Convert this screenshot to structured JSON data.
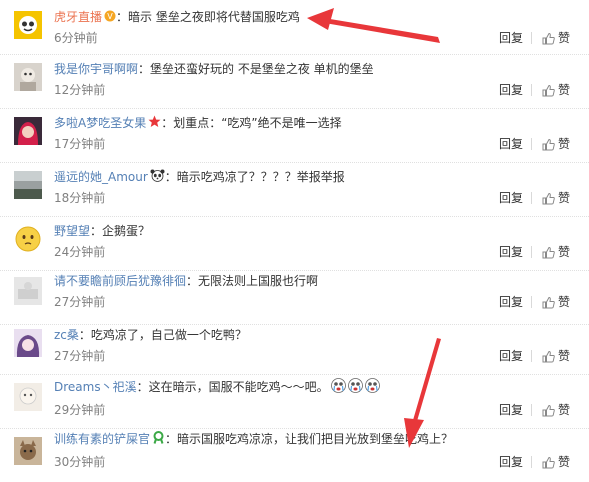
{
  "comments": [
    {
      "user": "虎牙直播",
      "text": "：暗示 堡垒之夜即将代替国服吃鸡",
      "time": "6分钟前"
    },
    {
      "user": "我是你宇哥啊啊",
      "text": "：堡垒还蛮好玩的 不是堡垒之夜 单机的堡垒",
      "time": "12分钟前"
    },
    {
      "user": "多啦A梦吃圣女果",
      "text": "：划重点：“吃鸡”绝不是唯一选择",
      "time": "17分钟前"
    },
    {
      "user": "遥远的她_Amour",
      "text": "：暗示吃鸡凉了？？？？举报举报",
      "time": "18分钟前"
    },
    {
      "user": "野望望",
      "text": "：企鹅蛋？",
      "time": "24分钟前"
    },
    {
      "user": "请不要瞻前顾后犹豫徘徊",
      "text": "：无限法则上国服也行啊",
      "time": "27分钟前"
    },
    {
      "user": "zc桑",
      "text": "：吃鸡凉了，自己做一个吃鸭？",
      "time": "27分钟前"
    },
    {
      "user": "Dreams丶祀溪",
      "text": "：这在暗示，国服不能吃鸡～～吧。",
      "time": "29分钟前"
    },
    {
      "user": "训练有素的铲屎官",
      "text": "：暗示国服吃鸡凉凉，让我们把目光放到堡垒吃鸡上？",
      "time": "30分钟前"
    }
  ],
  "actions": {
    "reply": "回复",
    "like": "赞"
  },
  "colors": {
    "username": "#5580b5",
    "highlight_user": "#eb7350",
    "time": "#808080",
    "arrow": "#e8373a"
  }
}
